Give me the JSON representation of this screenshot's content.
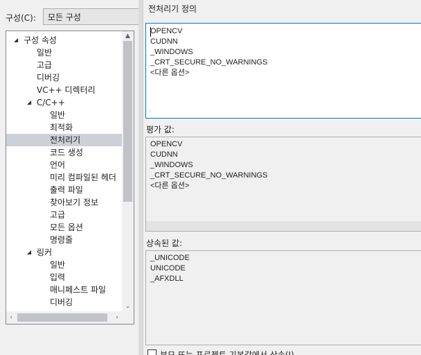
{
  "config": {
    "label": "구성(C):",
    "value": "모든 구성"
  },
  "tree": {
    "items": [
      {
        "label": "구성 속성",
        "arrow": "◢"
      },
      {
        "label": "일반",
        "arrow": ""
      },
      {
        "label": "고급",
        "arrow": ""
      },
      {
        "label": "디버깅",
        "arrow": ""
      },
      {
        "label": "VC++ 디렉터리",
        "arrow": ""
      },
      {
        "label": "C/C++",
        "arrow": "◢"
      },
      {
        "label": "일반",
        "arrow": ""
      },
      {
        "label": "최적화",
        "arrow": ""
      },
      {
        "label": "전처리기",
        "arrow": ""
      },
      {
        "label": "코드 생성",
        "arrow": ""
      },
      {
        "label": "언어",
        "arrow": ""
      },
      {
        "label": "미리 컴파일된 헤더",
        "arrow": ""
      },
      {
        "label": "출력 파일",
        "arrow": ""
      },
      {
        "label": "찾아보기 정보",
        "arrow": ""
      },
      {
        "label": "고급",
        "arrow": ""
      },
      {
        "label": "모든 옵션",
        "arrow": ""
      },
      {
        "label": "명령줄",
        "arrow": ""
      },
      {
        "label": "링커",
        "arrow": "◢"
      },
      {
        "label": "일반",
        "arrow": ""
      },
      {
        "label": "입력",
        "arrow": ""
      },
      {
        "label": "매니페스트 파일",
        "arrow": ""
      },
      {
        "label": "디버깅",
        "arrow": ""
      }
    ],
    "selected": "전처리기"
  },
  "dialog": {
    "title": "전처리기 정의",
    "edit_lines": [
      "OPENCV",
      "CUDNN",
      "_WINDOWS",
      "_CRT_SECURE_NO_WARNINGS",
      "<다른 옵션>"
    ],
    "evaluated_label": "평가 값:",
    "evaluated_lines": [
      "OPENCV",
      "CUDNN",
      "_WINDOWS",
      "_CRT_SECURE_NO_WARNINGS",
      "<다른 옵션>"
    ],
    "inherited_label": "상속된 값:",
    "inherited_lines": [
      "_UNICODE",
      "UNICODE",
      "_AFXDLL"
    ],
    "inherit_checkbox_label": "부모 또는 프로젝트 기본값에서 상속(I)"
  },
  "icons": {
    "scroll_up": "chevron-up-icon",
    "scroll_down": "chevron-down-icon",
    "scroll_left": "chevron-left-icon",
    "scroll_right": "chevron-right-icon",
    "tree_expanded": "tree-expanded-icon"
  },
  "colors": {
    "selection": "#cdd0d9",
    "focus_border": "#0078d7",
    "window_bg": "#f0f0f0"
  }
}
